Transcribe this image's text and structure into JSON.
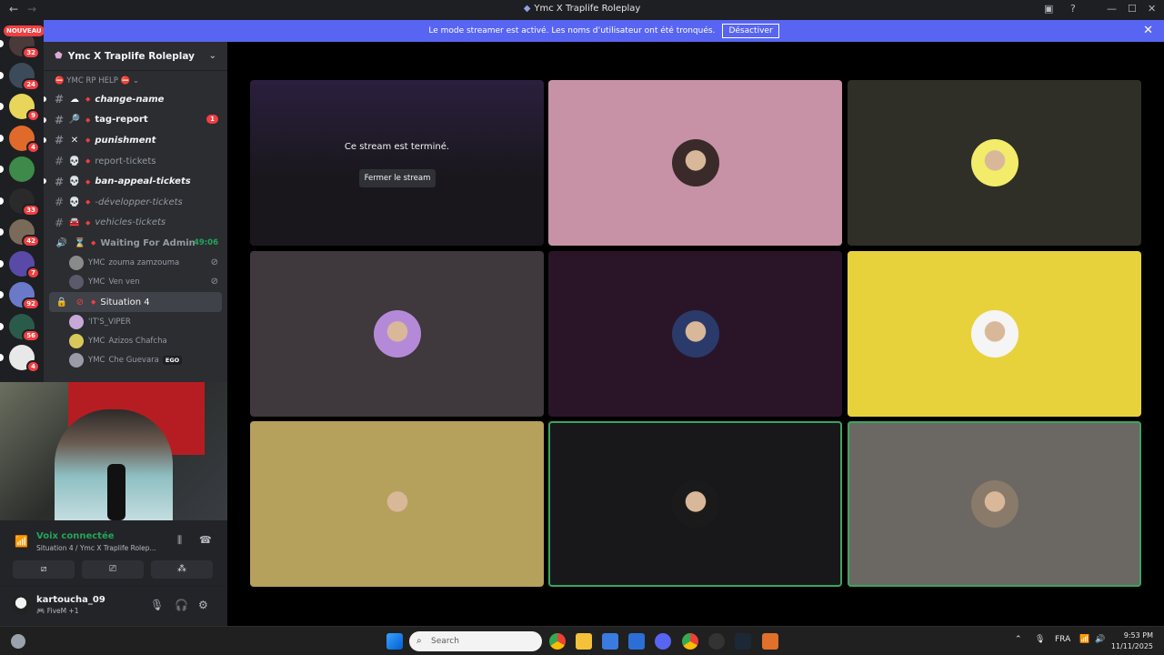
{
  "window": {
    "title": "Ymc X Traplife Roleplay",
    "back": "←",
    "forward": "→"
  },
  "banner": {
    "text": "Le mode streamer est activé. Les noms d’utilisateur ont été tronqués.",
    "button": "Désactiver",
    "close": "✕"
  },
  "rail": {
    "new_label": "NOUVEAU",
    "servers": [
      {
        "badge": "32",
        "color": "#4a3a3a"
      },
      {
        "badge": "24",
        "color": "#3c4b5a"
      },
      {
        "badge": "9",
        "color": "#e8d65a"
      },
      {
        "badge": "4",
        "color": "#e06a2a"
      },
      {
        "badge": "",
        "color": "#3d8a4a"
      },
      {
        "badge": "33",
        "color": "#2a2a2a"
      },
      {
        "badge": "42",
        "color": "#7a6a5a"
      },
      {
        "badge": "7",
        "color": "#5a4aa8"
      },
      {
        "badge": "92",
        "color": "#6a7ac8"
      },
      {
        "badge": "56",
        "color": "#2a5a4a"
      },
      {
        "badge": "4",
        "color": "#e8e8e8"
      }
    ]
  },
  "sidebar": {
    "server_name": "Ymc X Traplife Roleplay",
    "category": "YMC RP HELP",
    "channels": [
      {
        "icon": "☁",
        "name": "change-name",
        "unread": true,
        "italic": true
      },
      {
        "icon": "🔎",
        "name": "tag-report",
        "unread": true,
        "badge": "1"
      },
      {
        "icon": "✕",
        "name": "punishment",
        "unread": true,
        "italic": true
      },
      {
        "icon": "💀",
        "name": "report-tickets",
        "unread": false
      },
      {
        "icon": "💀",
        "name": "ban-appeal-tickets",
        "unread": true,
        "italic": true
      },
      {
        "icon": "💀",
        "name": "-développer-tickets",
        "unread": false,
        "italic": true
      },
      {
        "icon": "🚘",
        "name": "vehicles-tickets",
        "unread": false,
        "italic": true
      }
    ],
    "voice_waiting": {
      "name": "Waiting For Admin",
      "timer": "49:06"
    },
    "waiting_users": [
      {
        "prefix": "YMC",
        "name": "zouma zamzouma"
      },
      {
        "prefix": "YMC",
        "name": "Ven ven"
      }
    ],
    "voice_situation": {
      "name": "Situation 4"
    },
    "situation_users": [
      {
        "prefix": "",
        "name": "'IT'S_VIPER"
      },
      {
        "prefix": "YMC",
        "name": "Azizos Chafcha"
      },
      {
        "prefix": "YMC",
        "name": "Che Guevara",
        "tag": "EGO"
      }
    ]
  },
  "voice": {
    "status": "Voix connectée",
    "channel": "Situation 4 / Ymc X Traplife Rolep..."
  },
  "user": {
    "name": "kartoucha_09",
    "activity": "FiveM +1"
  },
  "stream": {
    "ended_text": "Ce stream est terminé.",
    "close_button": "Fermer le stream"
  },
  "tiles": [
    {
      "bg": "#2a1f3d",
      "type": "ended"
    },
    {
      "bg": "#c792a6",
      "avatar": "#3a2a2a",
      "speaking": false
    },
    {
      "bg": "#2f2f27",
      "avatar": "#f2ec6a",
      "speaking": false
    },
    {
      "bg": "#3f383d",
      "avatar": "#b48ad8",
      "speaking": false
    },
    {
      "bg": "#2a1528",
      "avatar": "#2a3a6a",
      "speaking": false
    },
    {
      "bg": "#e8d23c",
      "avatar": "#f5f5f5",
      "speaking": false
    },
    {
      "bg": "#b5a05c",
      "avatar": "#b5a05c",
      "speaking": false
    },
    {
      "bg": "#18181b",
      "avatar": "#1a1a1a",
      "speaking": true
    },
    {
      "bg": "#6b6763",
      "avatar": "#8a7a6a",
      "speaking": true
    }
  ],
  "taskbar": {
    "search": "Search",
    "lang": "FRA",
    "time": "9:53 PM",
    "date": "11/11/2025"
  },
  "colors": {
    "accent": "#5865f2",
    "online": "#23a55a",
    "danger": "#f23f42"
  }
}
